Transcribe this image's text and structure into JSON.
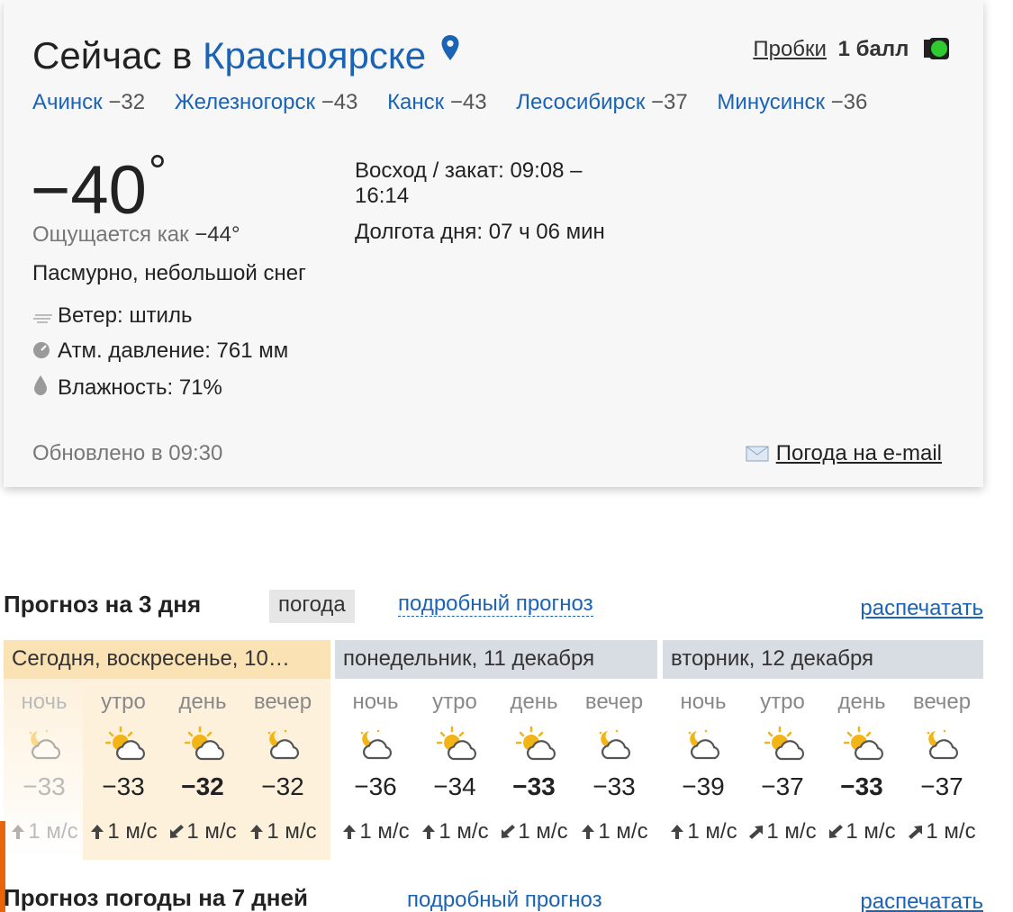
{
  "current": {
    "title_prefix": "Сейчас в",
    "city": "Красноярске",
    "traffic_label": "Пробки",
    "traffic_score": "1 балл",
    "nearby": [
      {
        "name": "Ачинск",
        "temp": "−32"
      },
      {
        "name": "Железногорск",
        "temp": "−43"
      },
      {
        "name": "Канск",
        "temp": "−43"
      },
      {
        "name": "Лесосибирск",
        "temp": "−37"
      },
      {
        "name": "Минусинск",
        "temp": "−36"
      }
    ],
    "temperature": "−40",
    "degree": "°",
    "feels_label": "Ощущается как",
    "feels_value": "−44°",
    "condition": "Пасмурно, небольшой снег",
    "wind": "Ветер: штиль",
    "pressure": "Атм. давление: 761 мм",
    "humidity": "Влажность: 71%",
    "sunrise_sunset": "Восход / закат: 09:08 – 16:14",
    "day_length": "Долгота дня: 07 ч 06 мин",
    "updated": "Обновлено в 09:30",
    "email_link": "Погода на e-mail",
    "colors": {
      "link": "#1a63b5",
      "traffic_green": "#2ecc2e"
    }
  },
  "forecast3": {
    "title": "Прогноз на 3 дня",
    "tab": "погода",
    "detailed_link": "подробный прогноз",
    "print_link": "распечатать",
    "days": [
      {
        "header": "Сегодня, воскресенье, 10…",
        "parts": [
          {
            "label": "ночь",
            "icon": "night-cloudy-icon",
            "temp": "−33",
            "bold": false,
            "wind_dir": "up-arrow-icon",
            "wind": "1 м/с"
          },
          {
            "label": "утро",
            "icon": "sun-cloud-icon",
            "temp": "−33",
            "bold": false,
            "wind_dir": "up-arrow-icon",
            "wind": "1 м/с"
          },
          {
            "label": "день",
            "icon": "sun-cloud-icon",
            "temp": "−32",
            "bold": true,
            "wind_dir": "down-left-arrow-icon",
            "wind": "1 м/с"
          },
          {
            "label": "вечер",
            "icon": "night-cloudy-icon",
            "temp": "−32",
            "bold": false,
            "wind_dir": "up-arrow-icon",
            "wind": "1 м/с"
          }
        ]
      },
      {
        "header": "понедельник, 11 декабря",
        "parts": [
          {
            "label": "ночь",
            "icon": "night-cloudy-icon",
            "temp": "−36",
            "bold": false,
            "wind_dir": "up-arrow-icon",
            "wind": "1 м/с"
          },
          {
            "label": "утро",
            "icon": "sun-cloud-icon",
            "temp": "−34",
            "bold": false,
            "wind_dir": "up-arrow-icon",
            "wind": "1 м/с"
          },
          {
            "label": "день",
            "icon": "sun-cloud-icon",
            "temp": "−33",
            "bold": true,
            "wind_dir": "down-left-arrow-icon",
            "wind": "1 м/с"
          },
          {
            "label": "вечер",
            "icon": "night-cloudy-icon",
            "temp": "−33",
            "bold": false,
            "wind_dir": "up-arrow-icon",
            "wind": "1 м/с"
          }
        ]
      },
      {
        "header": "вторник, 12 декабря",
        "parts": [
          {
            "label": "ночь",
            "icon": "night-cloudy-icon",
            "temp": "−39",
            "bold": false,
            "wind_dir": "up-arrow-icon",
            "wind": "1 м/с"
          },
          {
            "label": "утро",
            "icon": "sun-cloud-icon",
            "temp": "−37",
            "bold": false,
            "wind_dir": "up-right-arrow-icon",
            "wind": "1 м/с"
          },
          {
            "label": "день",
            "icon": "sun-cloud-icon",
            "temp": "−33",
            "bold": true,
            "wind_dir": "down-left-arrow-icon",
            "wind": "1 м/с"
          },
          {
            "label": "вечер",
            "icon": "night-cloudy-icon",
            "temp": "−37",
            "bold": false,
            "wind_dir": "up-right-arrow-icon",
            "wind": "1 м/с"
          }
        ]
      }
    ]
  },
  "forecast7": {
    "title": "Прогноз погоды на 7 дней",
    "detailed_link": "подробный прогноз",
    "print_link": "распечатать"
  }
}
